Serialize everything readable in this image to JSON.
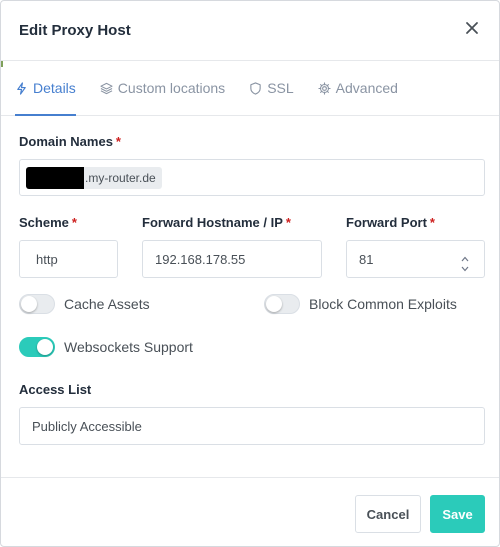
{
  "modal": {
    "title": "Edit Proxy Host"
  },
  "tabs": [
    {
      "label": "Details",
      "icon": "bolt-icon",
      "active": true
    },
    {
      "label": "Custom locations",
      "icon": "layers-icon",
      "active": false
    },
    {
      "label": "SSL",
      "icon": "shield-icon",
      "active": false
    },
    {
      "label": "Advanced",
      "icon": "gear-icon",
      "active": false
    }
  ],
  "form": {
    "domain_names": {
      "label": "Domain Names",
      "required_mark": "*",
      "chip_suffix": ".my-router.de"
    },
    "scheme": {
      "label": "Scheme",
      "required_mark": "*",
      "value": "http"
    },
    "forward_host": {
      "label": "Forward Hostname / IP",
      "required_mark": "*",
      "value": "192.168.178.55"
    },
    "forward_port": {
      "label": "Forward Port",
      "required_mark": "*",
      "value": "81"
    },
    "cache_assets": {
      "label": "Cache Assets",
      "on": false
    },
    "block_exploits": {
      "label": "Block Common Exploits",
      "on": false
    },
    "websockets": {
      "label": "Websockets Support",
      "on": true
    },
    "access_list": {
      "label": "Access List",
      "value": "Publicly Accessible"
    }
  },
  "footer": {
    "cancel_label": "Cancel",
    "save_label": "Save"
  },
  "colors": {
    "accent": "#467fcf",
    "teal": "#2bcbba",
    "required": "#cd201f"
  }
}
